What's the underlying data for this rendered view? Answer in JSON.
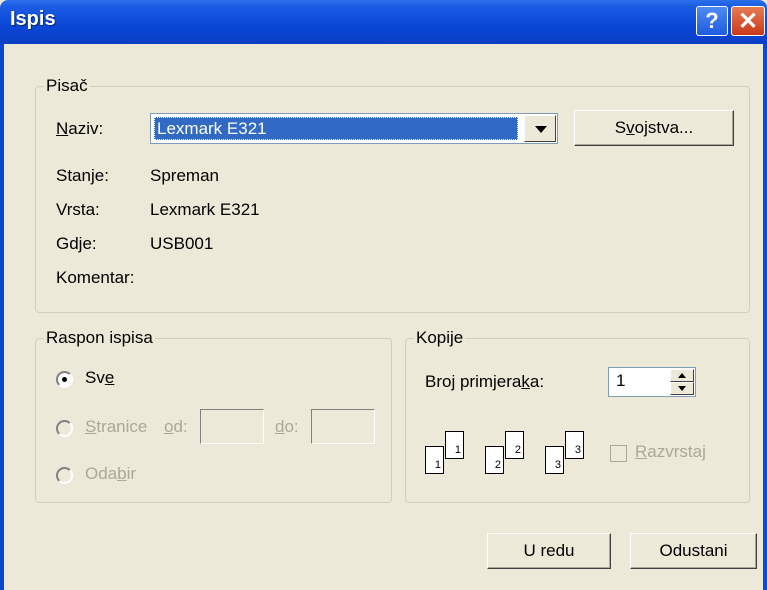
{
  "window": {
    "title": "Ispis",
    "help_glyph": "?",
    "close_glyph": "✕"
  },
  "printer": {
    "legend": "Pisač",
    "name_label": "Naziv:",
    "name_value": "Lexmark E321",
    "properties_button": "Svojstva...",
    "status_label": "Stanje:",
    "status_value": "Spreman",
    "type_label": "Vrsta:",
    "type_value": "Lexmark E321",
    "where_label": "Gdje:",
    "where_value": "USB001",
    "comment_label": "Komentar:"
  },
  "range": {
    "legend": "Raspon ispisa",
    "all_label": "Sve",
    "pages_label": "Stranice",
    "from_label": "od:",
    "to_label": "do:",
    "selection_label": "Odabir"
  },
  "copies": {
    "legend": "Kopije",
    "count_label": "Broj primjeraka:",
    "count_value": "1",
    "collate_label": "Razvrstaj",
    "collate_pages": [
      "1",
      "1",
      "2",
      "2",
      "3",
      "3"
    ]
  },
  "buttons": {
    "ok": "U redu",
    "cancel": "Odustani"
  },
  "icons": {
    "help": "help-icon",
    "close": "close-icon",
    "dropdown": "chevron-down-icon"
  }
}
